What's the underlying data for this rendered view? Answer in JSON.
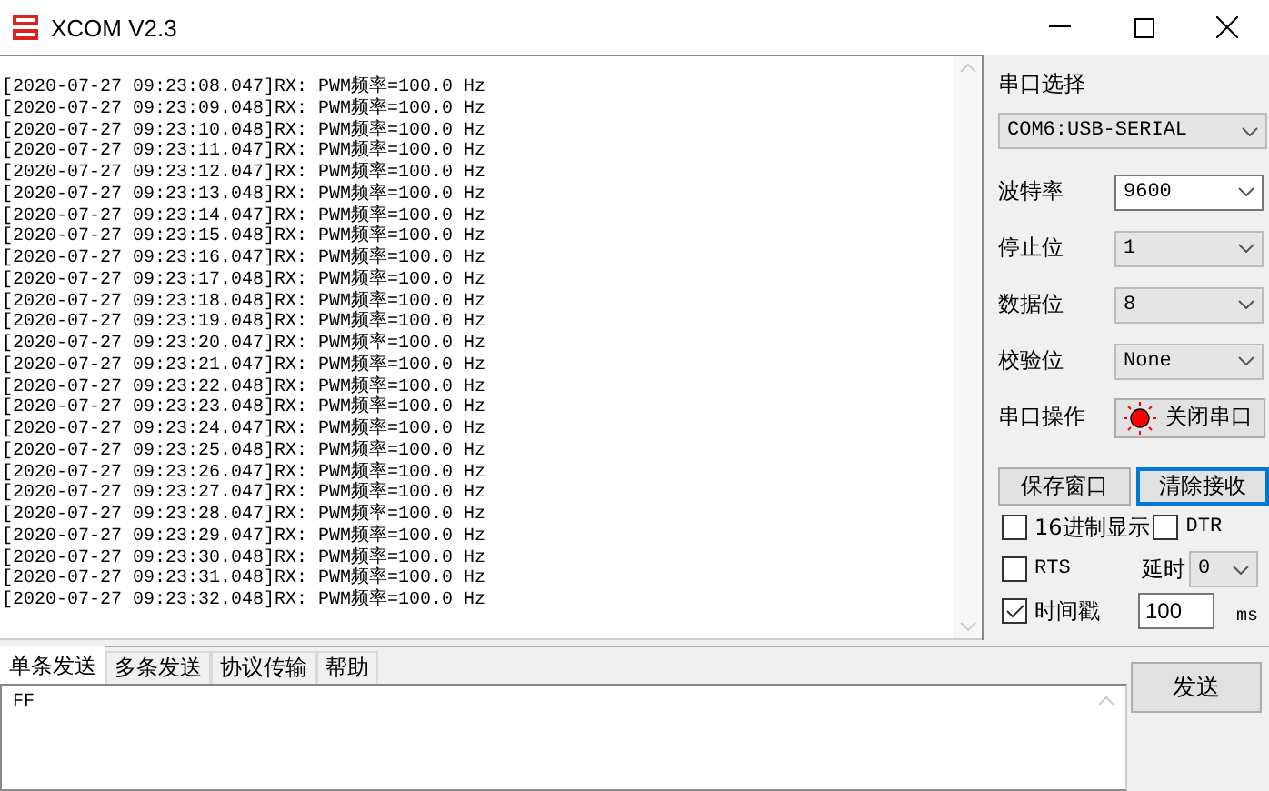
{
  "window": {
    "title": "XCOM V2.3"
  },
  "log": {
    "lines": [
      "[2020-07-27 09:23:08.047]RX: PWM频率=100.0 Hz",
      "[2020-07-27 09:23:09.048]RX: PWM频率=100.0 Hz",
      "[2020-07-27 09:23:10.048]RX: PWM频率=100.0 Hz",
      "[2020-07-27 09:23:11.047]RX: PWM频率=100.0 Hz",
      "[2020-07-27 09:23:12.047]RX: PWM频率=100.0 Hz",
      "[2020-07-27 09:23:13.048]RX: PWM频率=100.0 Hz",
      "[2020-07-27 09:23:14.047]RX: PWM频率=100.0 Hz",
      "[2020-07-27 09:23:15.048]RX: PWM频率=100.0 Hz",
      "[2020-07-27 09:23:16.047]RX: PWM频率=100.0 Hz",
      "[2020-07-27 09:23:17.048]RX: PWM频率=100.0 Hz",
      "[2020-07-27 09:23:18.048]RX: PWM频率=100.0 Hz",
      "[2020-07-27 09:23:19.048]RX: PWM频率=100.0 Hz",
      "[2020-07-27 09:23:20.047]RX: PWM频率=100.0 Hz",
      "[2020-07-27 09:23:21.047]RX: PWM频率=100.0 Hz",
      "[2020-07-27 09:23:22.048]RX: PWM频率=100.0 Hz",
      "[2020-07-27 09:23:23.048]RX: PWM频率=100.0 Hz",
      "[2020-07-27 09:23:24.047]RX: PWM频率=100.0 Hz",
      "[2020-07-27 09:23:25.048]RX: PWM频率=100.0 Hz",
      "[2020-07-27 09:23:26.047]RX: PWM频率=100.0 Hz",
      "[2020-07-27 09:23:27.047]RX: PWM频率=100.0 Hz",
      "[2020-07-27 09:23:28.047]RX: PWM频率=100.0 Hz",
      "[2020-07-27 09:23:29.047]RX: PWM频率=100.0 Hz",
      "[2020-07-27 09:23:30.048]RX: PWM频率=100.0 Hz",
      "[2020-07-27 09:23:31.048]RX: PWM频率=100.0 Hz",
      "[2020-07-27 09:23:32.048]RX: PWM频率=100.0 Hz"
    ]
  },
  "port": {
    "label": "串口选择",
    "value": "COM6:USB-SERIAL"
  },
  "settings": [
    {
      "label": "波特率",
      "value": "9600",
      "focused": true
    },
    {
      "label": "停止位",
      "value": "1",
      "focused": false
    },
    {
      "label": "数据位",
      "value": "8",
      "focused": false
    },
    {
      "label": "校验位",
      "value": "None",
      "focused": false
    }
  ],
  "operation": {
    "label": "串口操作",
    "button": "关闭串口",
    "on": true
  },
  "buttons": [
    {
      "label": "保存窗口",
      "focused": false
    },
    {
      "label": "清除接收",
      "focused": true
    }
  ],
  "options": {
    "hex": {
      "label": "16进制显示",
      "checked": false
    },
    "dtr": {
      "label": "DTR",
      "checked": false
    },
    "rts": {
      "label": "RTS",
      "checked": false
    },
    "delay_label": "延时",
    "delay_value": "0",
    "timestamp": {
      "label": "时间戳",
      "checked": true
    },
    "interval": "100",
    "unit": "ms"
  },
  "tabs": [
    {
      "label": "单条发送",
      "selected": true
    },
    {
      "label": "多条发送",
      "selected": false
    },
    {
      "label": "协议传输",
      "selected": false
    },
    {
      "label": "帮助",
      "selected": false
    }
  ],
  "send": {
    "value": "FF",
    "button": "发送"
  }
}
